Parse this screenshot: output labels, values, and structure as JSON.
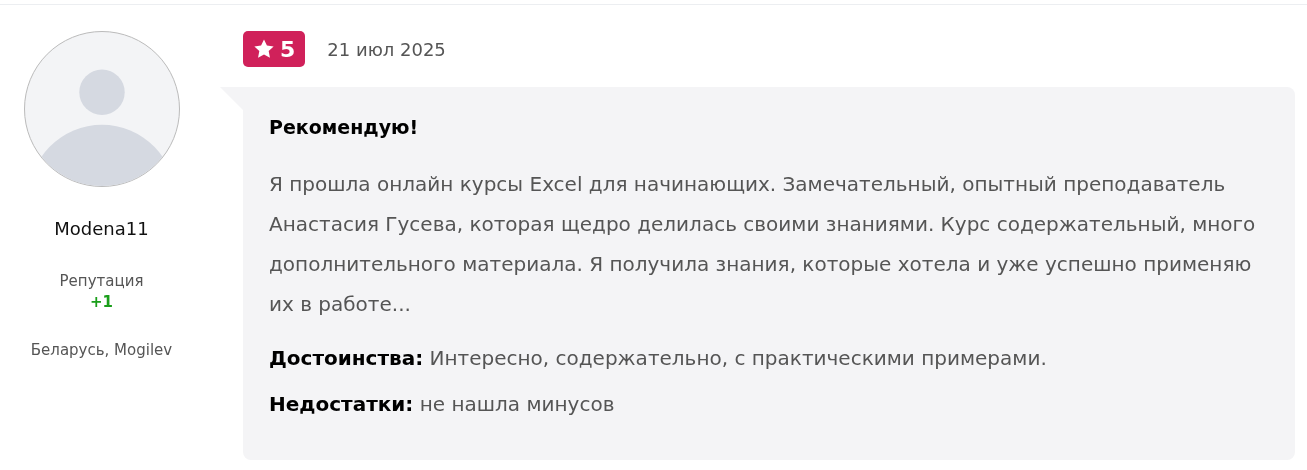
{
  "author": {
    "name": "Modena11",
    "reputation_label": "Репутация",
    "reputation_value": "+1",
    "location": "Беларусь, Mogilev"
  },
  "review": {
    "rating": "5",
    "date": "21 июл 2025",
    "title": "Рекомендую!",
    "text": "Я прошла онлайн курсы Excel для начинающих. Замечательный, опытный преподаватель Анастасия Гусева, которая щедро делилась своими знаниями. Курс содержательный, много дополнительного материала. Я получила знания, которые хотела и уже успешно применяю их в работе...",
    "pros": "**Достоинства:** Интересно, содержательно, с практическими примерами.",
    "cons": "**Недостатки:** не нашла минусов"
  }
}
